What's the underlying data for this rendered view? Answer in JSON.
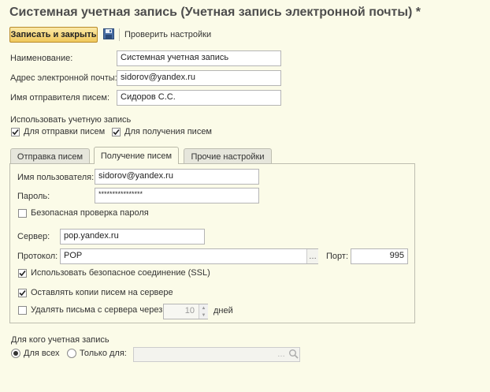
{
  "window": {
    "title": "Системная учетная запись (Учетная запись электронной почты) *"
  },
  "toolbar": {
    "save_close_label": "Записать и закрыть",
    "save_icon": "floppy-disk-icon",
    "check_settings_label": "Проверить настройки"
  },
  "fields": {
    "name": {
      "label": "Наименование:",
      "value": "Системная учетная запись"
    },
    "email": {
      "label": "Адрес электронной почты:",
      "value": "sidorov@yandex.ru"
    },
    "sender": {
      "label": "Имя отправителя писем:",
      "value": "Сидоров С.С."
    }
  },
  "usage": {
    "label": "Использовать учетную запись",
    "send": {
      "label": "Для отправки писем",
      "checked": true
    },
    "receive": {
      "label": "Для получения писем",
      "checked": true
    }
  },
  "tabs": [
    {
      "label": "Отправка писем",
      "active": false
    },
    {
      "label": "Получение писем",
      "active": true
    },
    {
      "label": "Прочие настройки",
      "active": false
    }
  ],
  "receive": {
    "username": {
      "label": "Имя пользователя:",
      "value": "sidorov@yandex.ru"
    },
    "password": {
      "label": "Пароль:",
      "value": "****************"
    },
    "secure_auth": {
      "label": "Безопасная проверка пароля",
      "checked": false
    },
    "server": {
      "label": "Сервер:",
      "value": "pop.yandex.ru"
    },
    "protocol": {
      "label": "Протокол:",
      "value": "POP"
    },
    "port": {
      "label": "Порт:",
      "value": "995"
    },
    "ssl": {
      "label": "Использовать безопасное соединение (SSL)",
      "checked": true
    },
    "keep_copies": {
      "label": "Оставлять копии писем на сервере",
      "checked": true
    },
    "delete_after": {
      "label": "Удалять письма с сервера через:",
      "checked": false,
      "value": "10",
      "unit": "дней"
    }
  },
  "owner": {
    "label": "Для кого учетная запись",
    "all": {
      "label": "Для всех",
      "selected": true
    },
    "only": {
      "label": "Только для:",
      "selected": false,
      "value": ""
    }
  },
  "colors": {
    "background": "#fbfbe8",
    "title": "#4d4d4d",
    "primary_button": "#f0c85c"
  }
}
